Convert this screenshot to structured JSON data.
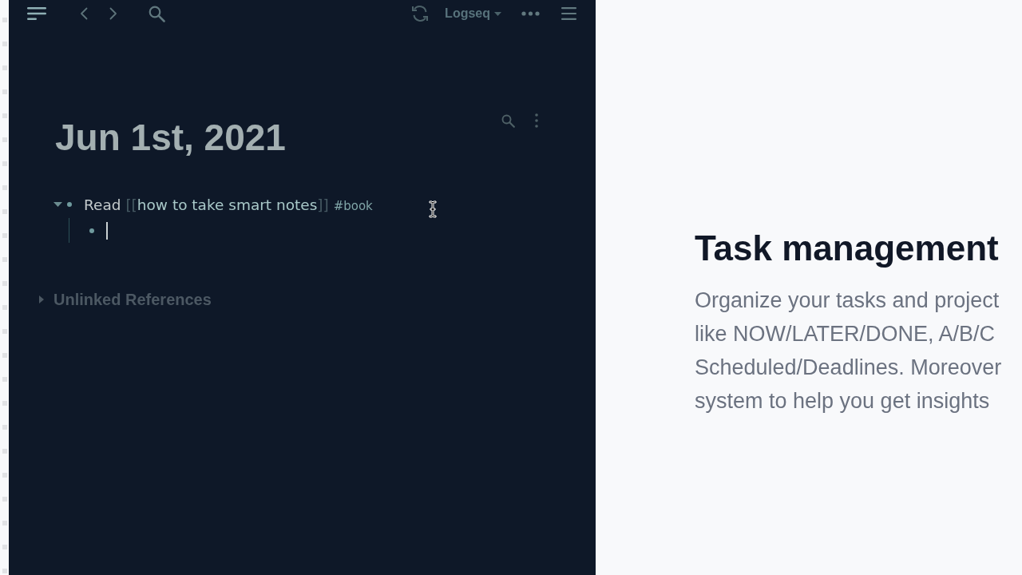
{
  "app": {
    "toolbar": {
      "graph_name": "Logseq"
    },
    "page": {
      "title": "Jun 1st, 2021",
      "blocks": [
        {
          "expanded": true,
          "segments": [
            {
              "kind": "text",
              "text": "Read"
            },
            {
              "kind": "page_ref",
              "open": "[[",
              "text": "how to take smart notes",
              "close": "]]"
            },
            {
              "kind": "tag",
              "text": "#book"
            }
          ],
          "children": [
            {
              "editing": true
            }
          ]
        }
      ],
      "unlinked_references": {
        "label": "Unlinked References",
        "expanded": false
      }
    }
  },
  "feature": {
    "title": "Task management",
    "description_lines": [
      "Organize your tasks and project",
      "like NOW/LATER/DONE, A/B/C",
      "Scheduled/Deadlines. Moreover",
      "system to help you get insights"
    ]
  }
}
